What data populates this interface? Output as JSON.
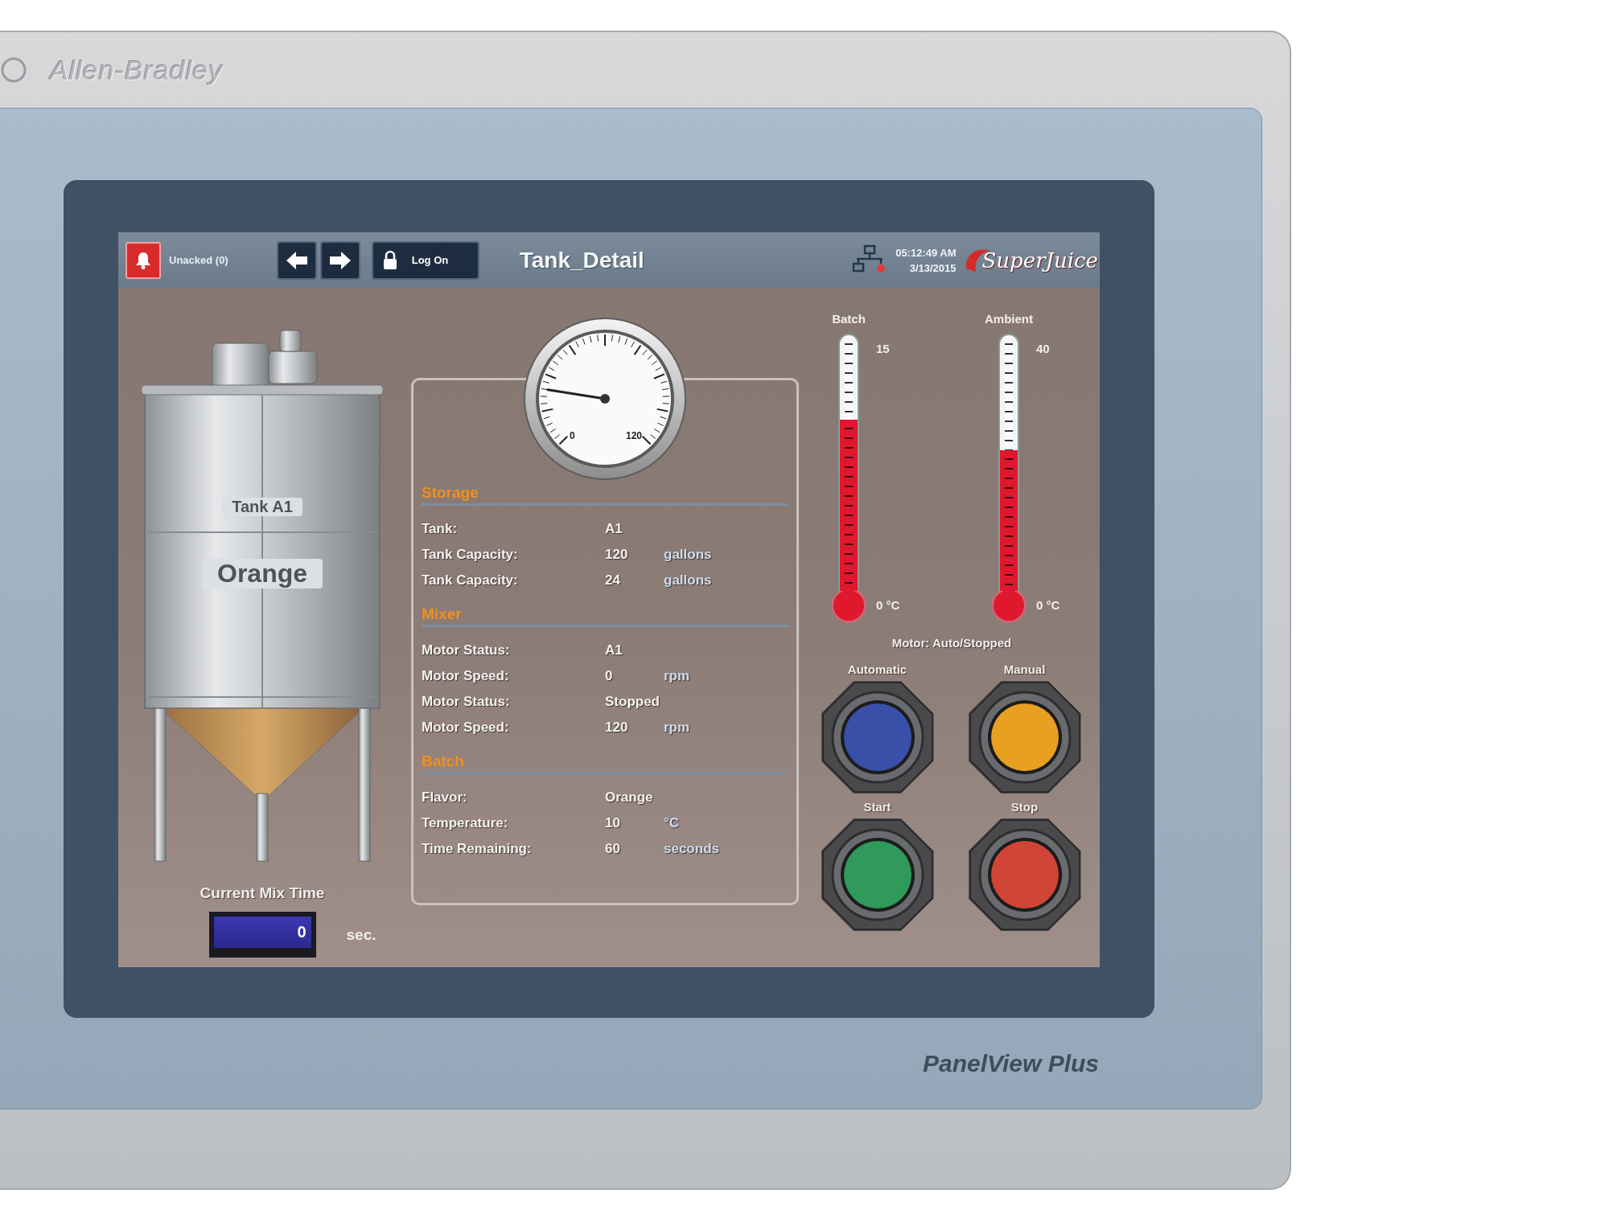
{
  "device": {
    "brand": "Allen-Bradley",
    "model": "PanelView Plus"
  },
  "header": {
    "alarm_label": "Unacked (0)",
    "login_button": "Log On",
    "title": "Tank_Detail",
    "time": "05:12:49 AM",
    "date": "3/13/2015",
    "logo": "SuperJuice"
  },
  "tank": {
    "name": "Tank A1",
    "contents": "Orange"
  },
  "mix_time": {
    "label": "Current Mix Time",
    "value": "0",
    "unit": "sec."
  },
  "gauge": {
    "min": "0",
    "max": "120",
    "level": 0.2
  },
  "sections": [
    {
      "title": "Storage",
      "rows": [
        {
          "label": "Tank:",
          "value": "A1"
        },
        {
          "label": "Tank Capacity:",
          "value": "120",
          "unit": "gallons"
        },
        {
          "label": "Tank Capacity:",
          "value": "24",
          "unit": "gallons"
        }
      ]
    },
    {
      "title": "Mixer",
      "rows": [
        {
          "label": "Motor Status:",
          "value": "A1"
        },
        {
          "label": "Motor Speed:",
          "value": "0",
          "unit": "rpm"
        },
        {
          "label": "Motor Status:",
          "value": "Stopped"
        },
        {
          "label": "Motor Speed:",
          "value": "120",
          "unit": "rpm"
        }
      ]
    },
    {
      "title": "Batch",
      "rows": [
        {
          "label": "Flavor:",
          "value": "Orange"
        },
        {
          "label": "Temperature:",
          "value": "10",
          "unit": "°C"
        },
        {
          "label": "Time Remaining:",
          "value": "60",
          "unit": "seconds"
        }
      ]
    }
  ],
  "thermometers": [
    {
      "label": "Batch",
      "max": "15",
      "min": "0 °C",
      "level": 0.67
    },
    {
      "label": "Ambient",
      "max": "40",
      "min": "0 °C",
      "level": 0.55
    }
  ],
  "motor_status": "Motor: Auto/Stopped",
  "buttons": [
    {
      "label": "Automatic",
      "color": "#3a4fa8"
    },
    {
      "label": "Manual",
      "color": "#e8a020"
    },
    {
      "label": "Start",
      "color": "#2f9a5a"
    },
    {
      "label": "Stop",
      "color": "#d04535"
    }
  ]
}
